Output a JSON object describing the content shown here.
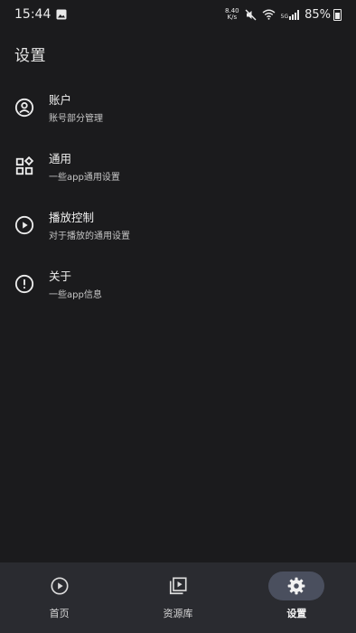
{
  "status_bar": {
    "time": "15:44",
    "net_speed_value": "8.40",
    "net_speed_unit": "K/s",
    "network_type": "5G",
    "battery": "85%",
    "icons": [
      "image-icon",
      "mute-icon",
      "wifi-icon",
      "signal-icon",
      "battery-icon"
    ]
  },
  "page": {
    "title": "设置"
  },
  "menu": {
    "items": [
      {
        "title": "账户",
        "subtitle": "账号部分管理",
        "icon": "account-icon"
      },
      {
        "title": "通用",
        "subtitle": "一些app通用设置",
        "icon": "widgets-icon"
      },
      {
        "title": "播放控制",
        "subtitle": "对于播放的通用设置",
        "icon": "play-circle-icon"
      },
      {
        "title": "关于",
        "subtitle": "一些app信息",
        "icon": "info-icon"
      }
    ]
  },
  "bottom_nav": {
    "items": [
      {
        "label": "首页",
        "icon": "play-circle-icon",
        "active": false
      },
      {
        "label": "资源库",
        "icon": "video-library-icon",
        "active": false
      },
      {
        "label": "设置",
        "icon": "gear-icon",
        "active": true
      }
    ]
  },
  "colors": {
    "background": "#1b1b1d",
    "nav_background": "#2a2b30",
    "active_pill": "#4a4f5e",
    "text_primary": "#f0f0f0",
    "text_secondary": "#c6c6c6"
  }
}
